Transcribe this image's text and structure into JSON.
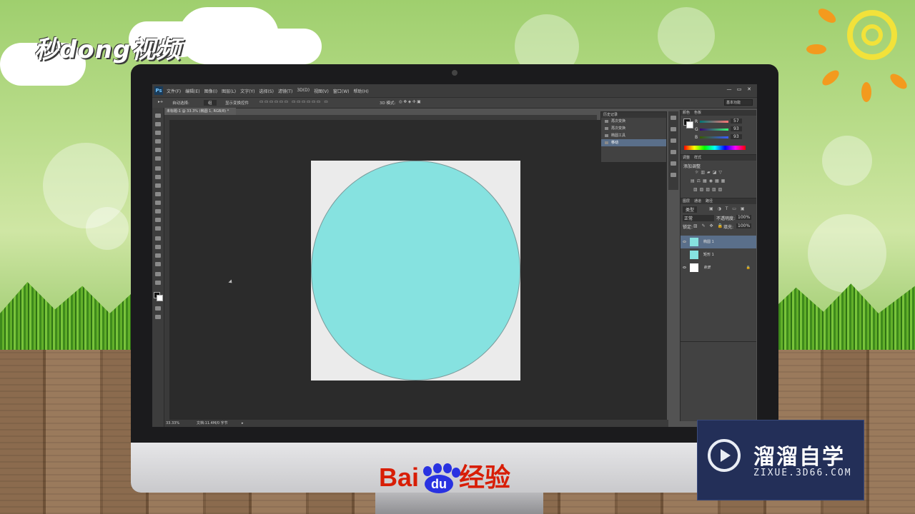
{
  "watermark": {
    "top_left_logo": "秒dong视频",
    "brand_text": "Bai",
    "brand_paw": "du",
    "brand_suffix": "经验",
    "zixue_title": "溜溜自学",
    "zixue_url": "ZIXUE.3D66.COM"
  },
  "photoshop": {
    "app_logo": "Ps",
    "menu": [
      "文件(F)",
      "编辑(E)",
      "图像(I)",
      "图层(L)",
      "文字(Y)",
      "选择(S)",
      "滤镜(T)",
      "3D(D)",
      "视图(V)",
      "窗口(W)",
      "帮助(H)"
    ],
    "window_buttons": [
      "—",
      "▭",
      "✕"
    ],
    "options": {
      "auto_select_label": "自动选择:",
      "auto_select_value": "组",
      "show_transform": "显示变换控件",
      "mode_3d": "3D 模式:",
      "workspace": "基本功能"
    },
    "document_tab": "未标题-1 @ 33.3% (椭圆 1, RGB/8) *",
    "status": {
      "zoom": "33.33%",
      "doc_info": "文档:11.4M/0 字节"
    },
    "history": {
      "title": "历史记录",
      "items": [
        "再次变换",
        "再次变换",
        "椭圆工具",
        "移动"
      ],
      "active_index": 3
    },
    "color_panel": {
      "tabs": [
        "颜色",
        "色板"
      ],
      "channels": [
        {
          "label": "R",
          "value": "57"
        },
        {
          "label": "G",
          "value": "93"
        },
        {
          "label": "B",
          "value": "93"
        }
      ]
    },
    "adjustments_panel": {
      "tabs": [
        "调整",
        "样式"
      ],
      "title": "添加调整"
    },
    "layers_panel": {
      "tabs": [
        "图层",
        "通道",
        "路径"
      ],
      "kind_filter": "类型",
      "blend_mode": "正常",
      "opacity_label": "不透明度:",
      "opacity_value": "100%",
      "lock_label": "锁定:",
      "fill_label": "填充:",
      "fill_value": "100%",
      "layers": [
        {
          "name": "椭圆 1",
          "selected": true,
          "thumb_color": "#86e2e0"
        },
        {
          "name": "矩形 1",
          "selected": false,
          "thumb_color": "#86e2e0"
        },
        {
          "name": "背景",
          "selected": false,
          "thumb_color": "#ffffff"
        }
      ]
    },
    "colors": {
      "ellipse_fill": "#86e2e0",
      "document_bg": "#ebebeb",
      "selection_highlight": "#5a6f8a"
    }
  }
}
